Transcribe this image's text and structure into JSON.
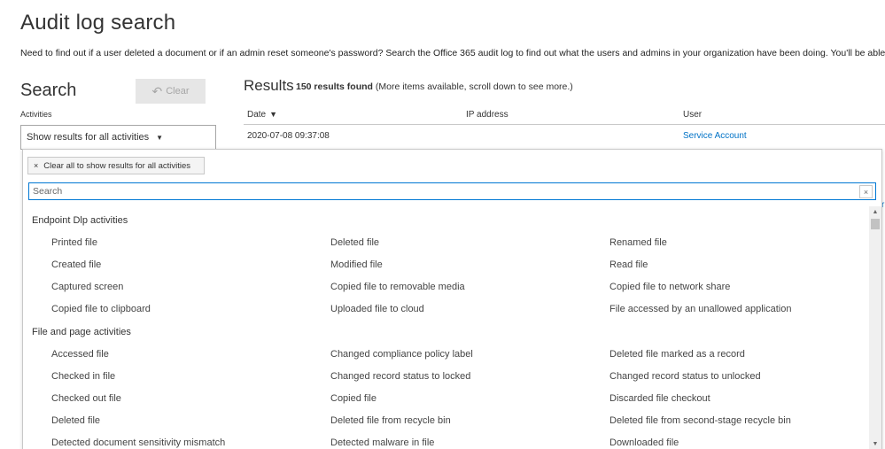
{
  "header": {
    "title": "Audit log search",
    "intro": "Need to find out if a user deleted a document or if an admin reset someone's password? Search the Office 365 audit log to find out what the users and admins in your organization have been doing. You'll be able"
  },
  "search": {
    "heading": "Search",
    "clear_label": "Clear",
    "activities_label": "Activities",
    "activities_value": "Show results for all activities",
    "chip_label": "Clear all to show results for all activities",
    "chip_close": "×",
    "search_placeholder": "Search",
    "search_clear": "×"
  },
  "results": {
    "heading": "Results",
    "count": "150 results found",
    "note": "(More items available, scroll down to see more.)",
    "columns": {
      "date": "Date",
      "ip": "IP address",
      "user": "User"
    },
    "sort_glyph": "▼",
    "rows": [
      {
        "date": "2020-07-08 09:37:08",
        "ip": "",
        "user": "Service Account"
      }
    ]
  },
  "activity_groups": [
    {
      "title": "Endpoint Dlp activities",
      "items": [
        "Printed file",
        "Deleted file",
        "Renamed file",
        "Created file",
        "Modified file",
        "Read file",
        "Captured screen",
        "Copied file to removable media",
        "Copied file to network share",
        "Copied file to clipboard",
        "Uploaded file to cloud",
        "File accessed by an unallowed application"
      ]
    },
    {
      "title": "File and page activities",
      "items": [
        "Accessed file",
        "Changed compliance policy label",
        "Deleted file marked as a record",
        "Checked in file",
        "Changed record status to locked",
        "Changed record status to unlocked",
        "Checked out file",
        "Copied file",
        "Discarded file checkout",
        "Deleted file",
        "Deleted file from recycle bin",
        "Deleted file from second-stage recycle bin",
        "Detected document sensitivity mismatch",
        "Detected malware in file",
        "Downloaded file"
      ]
    }
  ],
  "edge_glyph": "r",
  "icons": {
    "undo": "↶",
    "caret": "▼",
    "scroll_up": "▲",
    "scroll_down": "▼"
  }
}
